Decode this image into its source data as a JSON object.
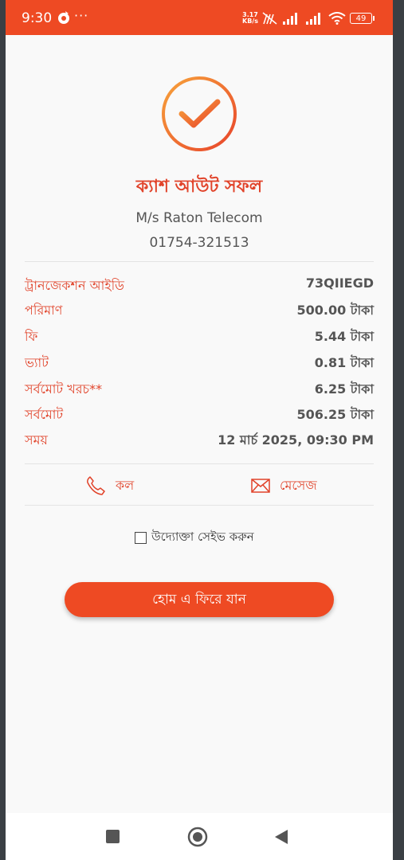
{
  "status_bar": {
    "time": "9:30",
    "dots": "···",
    "speed_value": "3.17",
    "speed_unit": "KB/s",
    "battery": "49"
  },
  "result": {
    "title": "ক্যাশ আউট সফল",
    "merchant_name": "M/s Raton Telecom",
    "merchant_phone": "01754-321513"
  },
  "details": [
    {
      "label": "ট্রানজেকশন আইডি",
      "value": "73QIIEGD"
    },
    {
      "label": "পরিমাণ",
      "value": "500.00 টাকা"
    },
    {
      "label": "ফি",
      "value": "5.44 টাকা"
    },
    {
      "label": "ভ্যাট",
      "value": "0.81 টাকা"
    },
    {
      "label": "সর্বমোট খরচ**",
      "value": "6.25 টাকা"
    },
    {
      "label": "সর্বমোট",
      "value": "506.25 টাকা"
    },
    {
      "label": "সময়",
      "value": "12 মার্চ 2025, 09:30 PM"
    }
  ],
  "actions": {
    "call_label": "কল",
    "message_label": "মেসেজ"
  },
  "save_label": "উদ্যোক্তা সেইভ করুন",
  "home_button": "হোম এ ফিরে যান",
  "colors": {
    "accent": "#ee4a23",
    "label_red": "#e1432a",
    "check_gradient_start": "#f7a33b",
    "check_gradient_end": "#e8442b"
  }
}
